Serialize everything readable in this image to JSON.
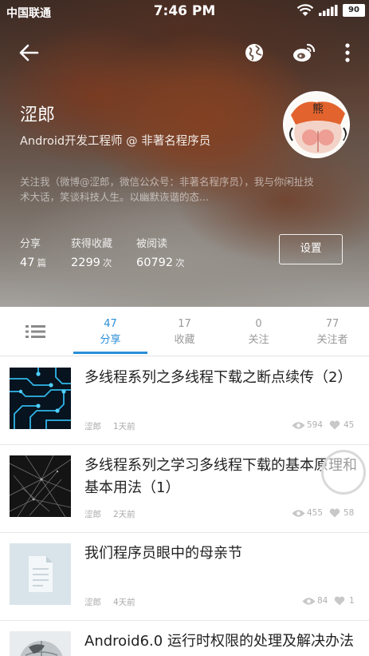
{
  "status_bar": {
    "carrier": "中国联通",
    "time": "7:46 PM",
    "battery": "90"
  },
  "profile": {
    "name": "涩郎",
    "title": "Android开发工程师 @ 非著名程序员",
    "bio": "关注我（微博@涩郎，微信公众号：非著名程序员），我与你闲扯技术大话，笑谈科技人生。以幽默诙谐的态...",
    "avatar_text": "熊",
    "settings_label": "设置",
    "stats": [
      {
        "label": "分享",
        "value": "47",
        "unit": "篇"
      },
      {
        "label": "获得收藏",
        "value": "2299",
        "unit": "次"
      },
      {
        "label": "被阅读",
        "value": "60792",
        "unit": "次"
      }
    ]
  },
  "tabs": [
    {
      "count": "47",
      "label": "分享",
      "active": true
    },
    {
      "count": "17",
      "label": "收藏"
    },
    {
      "count": "0",
      "label": "关注"
    },
    {
      "count": "77",
      "label": "关注者"
    }
  ],
  "articles": [
    {
      "title": "多线程系列之多线程下载之断点续传（2）",
      "author": "涩郎",
      "time": "1天前",
      "views": "594",
      "likes": "45",
      "thumb": "circuit"
    },
    {
      "title": "多线程系列之学习多线程下载的基本原理和基本用法（1）",
      "author": "涩郎",
      "time": "2天前",
      "views": "455",
      "likes": "58",
      "thumb": "network"
    },
    {
      "title": "我们程序员眼中的母亲节",
      "author": "涩郎",
      "time": "4天前",
      "views": "84",
      "likes": "1",
      "thumb": "document"
    },
    {
      "title": "Android6.0 运行时权限的处理及解决办法",
      "author": "",
      "time": "",
      "views": "",
      "likes": "",
      "thumb": "globe"
    }
  ],
  "colors": {
    "accent": "#2a8ed6",
    "text": "#222222",
    "muted": "#a9a9a9"
  }
}
